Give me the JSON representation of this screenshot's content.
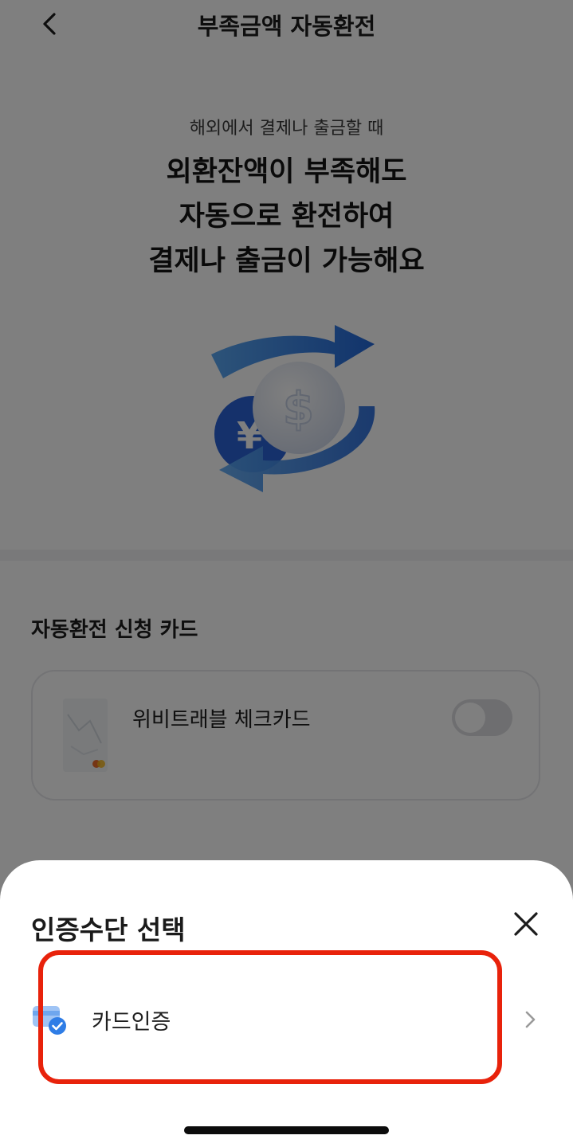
{
  "header": {
    "title": "부족금액 자동환전",
    "back_icon": "chevron-left-icon"
  },
  "hero": {
    "subtitle": "해외에서 결제나 출금할 때",
    "headline": [
      "외환잔액이 부족해도",
      "자동으로 환전하여",
      "결제나 출금이 가능해요"
    ],
    "illustration": "currency-exchange-illustration"
  },
  "card_section": {
    "title": "자동환전 신청 카드",
    "card": {
      "name": "위비트래블 체크카드",
      "toggle_on": false
    }
  },
  "sheet": {
    "title": "인증수단 선택",
    "close_icon": "close-icon",
    "options": [
      {
        "label": "카드인증",
        "icon": "card-verify-icon",
        "chevron": "chevron-right-icon"
      }
    ]
  },
  "colors": {
    "highlight": "#e8220b",
    "accent_blue": "#2f7de6",
    "dim": "rgba(0,0,0,0.5)"
  }
}
